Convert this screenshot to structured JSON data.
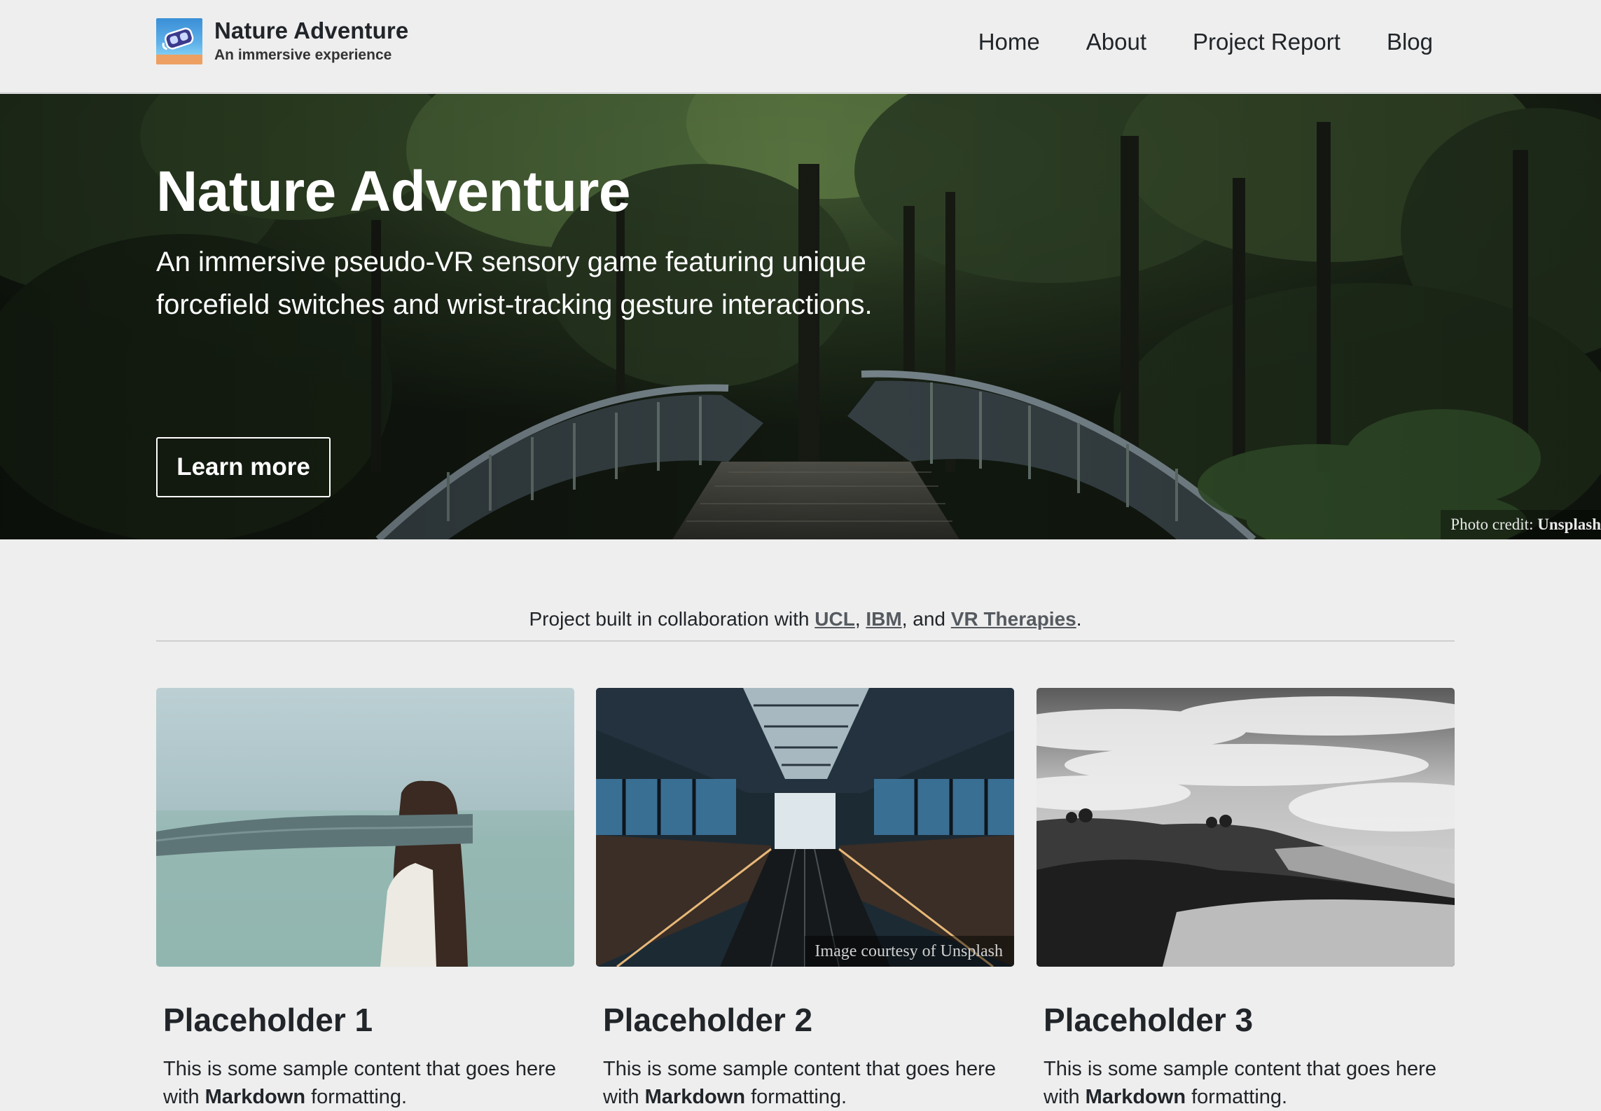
{
  "navbar": {
    "brand_title": "Nature Adventure",
    "brand_tagline": "An immersive experience",
    "links": [
      "Home",
      "About",
      "Project Report",
      "Blog"
    ]
  },
  "hero": {
    "title": "Nature Adventure",
    "lead": "An immersive pseudo-VR sensory game featuring unique forcefield switches and wrist-tracking gesture interactions.",
    "button_label": "Learn more",
    "photo_credit_prefix": "Photo credit:",
    "photo_credit_source": "Unsplash"
  },
  "collab": {
    "prefix": "Project built in collaboration with ",
    "partners": [
      "UCL",
      "IBM",
      "VR Therapies"
    ],
    "sep1": ", ",
    "sep2": ", and ",
    "suffix": "."
  },
  "cards": [
    {
      "title": "Placeholder 1",
      "text_before": "This is some sample content that goes here with ",
      "text_bold": "Markdown",
      "text_after": " formatting."
    },
    {
      "title": "Placeholder 2",
      "text_before": "This is some sample content that goes here with ",
      "text_bold": "Markdown",
      "text_after": " formatting.",
      "image_caption": "Image courtesy of Unsplash"
    },
    {
      "title": "Placeholder 3",
      "text_before": "This is some sample content that goes here with ",
      "text_bold": "Markdown",
      "text_after": " formatting."
    }
  ],
  "colors": {
    "page_background": "#eeeeee",
    "text": "#212529",
    "link": "#555a60",
    "hero_overlay": "#1a2418"
  },
  "icons": {
    "brand_logo": "vr-headset-logo-icon"
  }
}
